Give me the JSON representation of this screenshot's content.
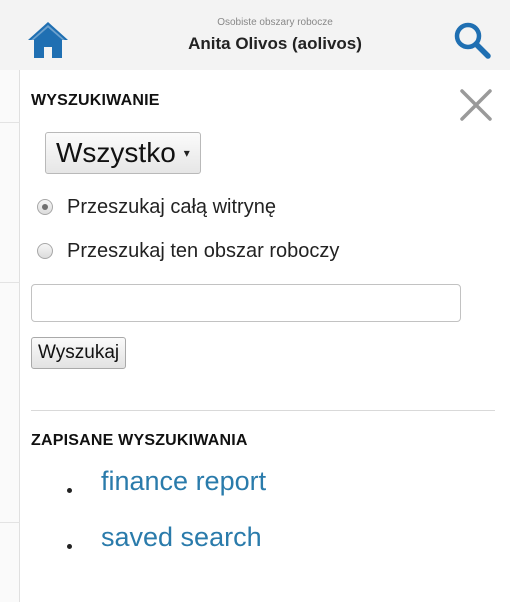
{
  "header": {
    "subtitle": "Osobiste obszary robocze",
    "title": "Anita Olivos (aolivos)",
    "home_icon": "home-icon",
    "search_icon": "search-icon",
    "accent_color": "#1f6fb2"
  },
  "search_panel": {
    "heading": "WYSZUKIWANIE",
    "close_icon": "close-icon",
    "scope_select": {
      "selected": "Wszystko",
      "caret": "▾"
    },
    "radios": [
      {
        "label": "Przeszukaj całą witrynę",
        "checked": true
      },
      {
        "label": "Przeszukaj ten obszar roboczy",
        "checked": false
      }
    ],
    "query_input": {
      "value": "",
      "placeholder": ""
    },
    "search_button_label": "Wyszukaj"
  },
  "saved_searches": {
    "heading": "ZAPISANE WYSZUKIWANIA",
    "link_color": "#2a7bab",
    "items": [
      {
        "label": "finance report"
      },
      {
        "label": "saved search"
      }
    ]
  }
}
